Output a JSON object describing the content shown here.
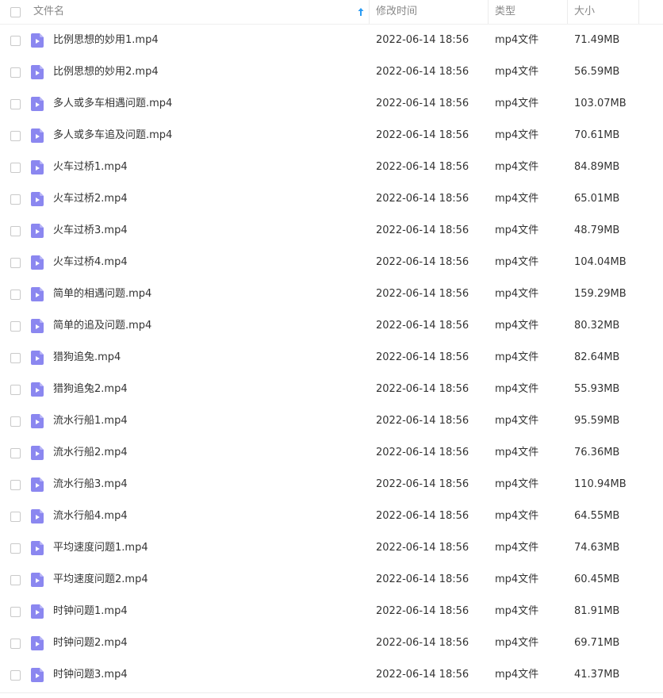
{
  "columns": {
    "name": "文件名",
    "modified": "修改时间",
    "type": "类型",
    "size": "大小"
  },
  "sort": {
    "column": "name",
    "direction": "ascending",
    "icon": "arrow-up-icon",
    "color": "#2a9bf3"
  },
  "icon_color": "#8b87f0",
  "files": [
    {
      "name": "比例思想的妙用1.mp4",
      "date": "2022-06-14 18:56",
      "type": "mp4文件",
      "size": "71.49MB"
    },
    {
      "name": "比例思想的妙用2.mp4",
      "date": "2022-06-14 18:56",
      "type": "mp4文件",
      "size": "56.59MB"
    },
    {
      "name": "多人或多车相遇问题.mp4",
      "date": "2022-06-14 18:56",
      "type": "mp4文件",
      "size": "103.07MB"
    },
    {
      "name": "多人或多车追及问题.mp4",
      "date": "2022-06-14 18:56",
      "type": "mp4文件",
      "size": "70.61MB"
    },
    {
      "name": "火车过桥1.mp4",
      "date": "2022-06-14 18:56",
      "type": "mp4文件",
      "size": "84.89MB"
    },
    {
      "name": "火车过桥2.mp4",
      "date": "2022-06-14 18:56",
      "type": "mp4文件",
      "size": "65.01MB"
    },
    {
      "name": "火车过桥3.mp4",
      "date": "2022-06-14 18:56",
      "type": "mp4文件",
      "size": "48.79MB"
    },
    {
      "name": "火车过桥4.mp4",
      "date": "2022-06-14 18:56",
      "type": "mp4文件",
      "size": "104.04MB"
    },
    {
      "name": "简单的相遇问题.mp4",
      "date": "2022-06-14 18:56",
      "type": "mp4文件",
      "size": "159.29MB"
    },
    {
      "name": "简单的追及问题.mp4",
      "date": "2022-06-14 18:56",
      "type": "mp4文件",
      "size": "80.32MB"
    },
    {
      "name": "猎狗追兔.mp4",
      "date": "2022-06-14 18:56",
      "type": "mp4文件",
      "size": "82.64MB"
    },
    {
      "name": "猎狗追兔2.mp4",
      "date": "2022-06-14 18:56",
      "type": "mp4文件",
      "size": "55.93MB"
    },
    {
      "name": "流水行船1.mp4",
      "date": "2022-06-14 18:56",
      "type": "mp4文件",
      "size": "95.59MB"
    },
    {
      "name": "流水行船2.mp4",
      "date": "2022-06-14 18:56",
      "type": "mp4文件",
      "size": "76.36MB"
    },
    {
      "name": "流水行船3.mp4",
      "date": "2022-06-14 18:56",
      "type": "mp4文件",
      "size": "110.94MB"
    },
    {
      "name": "流水行船4.mp4",
      "date": "2022-06-14 18:56",
      "type": "mp4文件",
      "size": "64.55MB"
    },
    {
      "name": "平均速度问题1.mp4",
      "date": "2022-06-14 18:56",
      "type": "mp4文件",
      "size": "74.63MB"
    },
    {
      "name": "平均速度问题2.mp4",
      "date": "2022-06-14 18:56",
      "type": "mp4文件",
      "size": "60.45MB"
    },
    {
      "name": "时钟问题1.mp4",
      "date": "2022-06-14 18:56",
      "type": "mp4文件",
      "size": "81.91MB"
    },
    {
      "name": "时钟问题2.mp4",
      "date": "2022-06-14 18:56",
      "type": "mp4文件",
      "size": "69.71MB"
    },
    {
      "name": "时钟问题3.mp4",
      "date": "2022-06-14 18:56",
      "type": "mp4文件",
      "size": "41.37MB"
    }
  ]
}
